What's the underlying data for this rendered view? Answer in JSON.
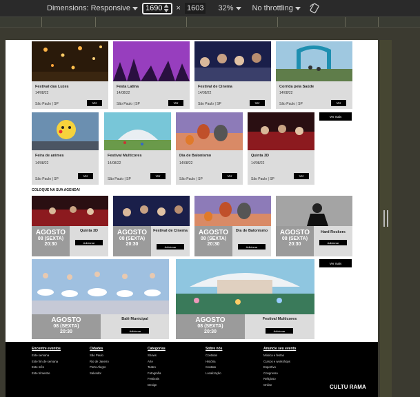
{
  "devtools": {
    "dimensions_label": "Dimensions: Responsive",
    "width_value": "1690",
    "times": "×",
    "height_value": "1603",
    "zoom": "32%",
    "throttling": "No throttling"
  },
  "events_row1": [
    {
      "title": "Festival das Luzes",
      "date": "14/08/22",
      "city": "São Paulo | SP",
      "button": "Ver"
    },
    {
      "title": "Festa Latina",
      "date": "14/08/22",
      "city": "São Paulo | SP",
      "button": "Ver"
    },
    {
      "title": "Festival de Cinema",
      "date": "14/08/22",
      "city": "São Paulo | SP",
      "button": "Ver"
    },
    {
      "title": "Corrida pela Saúde",
      "date": "14/08/22",
      "city": "São Paulo | SP",
      "button": "Ver"
    }
  ],
  "events_row2": [
    {
      "title": "Feira de animes",
      "date": "14/08/22",
      "city": "São Paulo | SP",
      "button": "Ver"
    },
    {
      "title": "Festival Multicores",
      "date": "14/08/22",
      "city": "São Paulo | SP",
      "button": "Ver"
    },
    {
      "title": "Dia de Balonismo",
      "date": "14/08/22",
      "city": "São Paulo | SP",
      "button": "Ver"
    },
    {
      "title": "Quinta 3D",
      "date": "14/08/22",
      "city": "São Paulo | SP",
      "button": "Ver"
    }
  ],
  "see_more": "Ver mais",
  "agenda_title": "COLOQUE NA SUA AGENDA!",
  "agenda_row1": [
    {
      "month": "AGOSTO",
      "day": "08 (SEXTA)",
      "time": "20:30",
      "name": "Quinta 3D",
      "button": "Adicionar"
    },
    {
      "month": "AGOSTO",
      "day": "08 (SEXTA)",
      "time": "20:30",
      "name": "Festival de Cinema",
      "button": "Adicionar"
    },
    {
      "month": "AGOSTO",
      "day": "08 (SEXTA)",
      "time": "20:30",
      "name": "Dia de Balonismo",
      "button": "Adicionar"
    },
    {
      "month": "AGOSTO",
      "day": "08 (SEXTA)",
      "time": "20:30",
      "name": "Hard Rockers",
      "button": "Adicionar"
    }
  ],
  "agenda_row2": [
    {
      "month": "AGOSTO",
      "day": "08 (SEXTA)",
      "time": "20:30",
      "name": "Balé Municipal",
      "button": "Adicionar"
    },
    {
      "month": "AGOSTO",
      "day": "08 (SEXTA)",
      "time": "20:30",
      "name": "Festival Multicores",
      "button": "Adicionar"
    }
  ],
  "footer": {
    "columns": [
      {
        "heading": "Encontre eventos",
        "items": [
          "Este semana",
          "Este fim de semana",
          "Este mês",
          "Este trimestre"
        ]
      },
      {
        "heading": "Cidades",
        "items": [
          "São Paulo",
          "Rio de Janeiro",
          "Porto Alegre",
          "Salvador"
        ]
      },
      {
        "heading": "Categorias",
        "items": [
          "Shows",
          "Arte",
          "Teatro",
          "Fotografia",
          "Festivais",
          "Design"
        ]
      },
      {
        "heading": "Sobre nós",
        "items": [
          "Contatos",
          "História",
          "Contato",
          "Localização"
        ]
      },
      {
        "heading": "Anuncie seu evento",
        "items": [
          "Música e festas",
          "Cursos e workshops",
          "Esportivo",
          "Congresso",
          "Religioso",
          "Online"
        ]
      }
    ],
    "logo": "CULTU RAMA"
  }
}
